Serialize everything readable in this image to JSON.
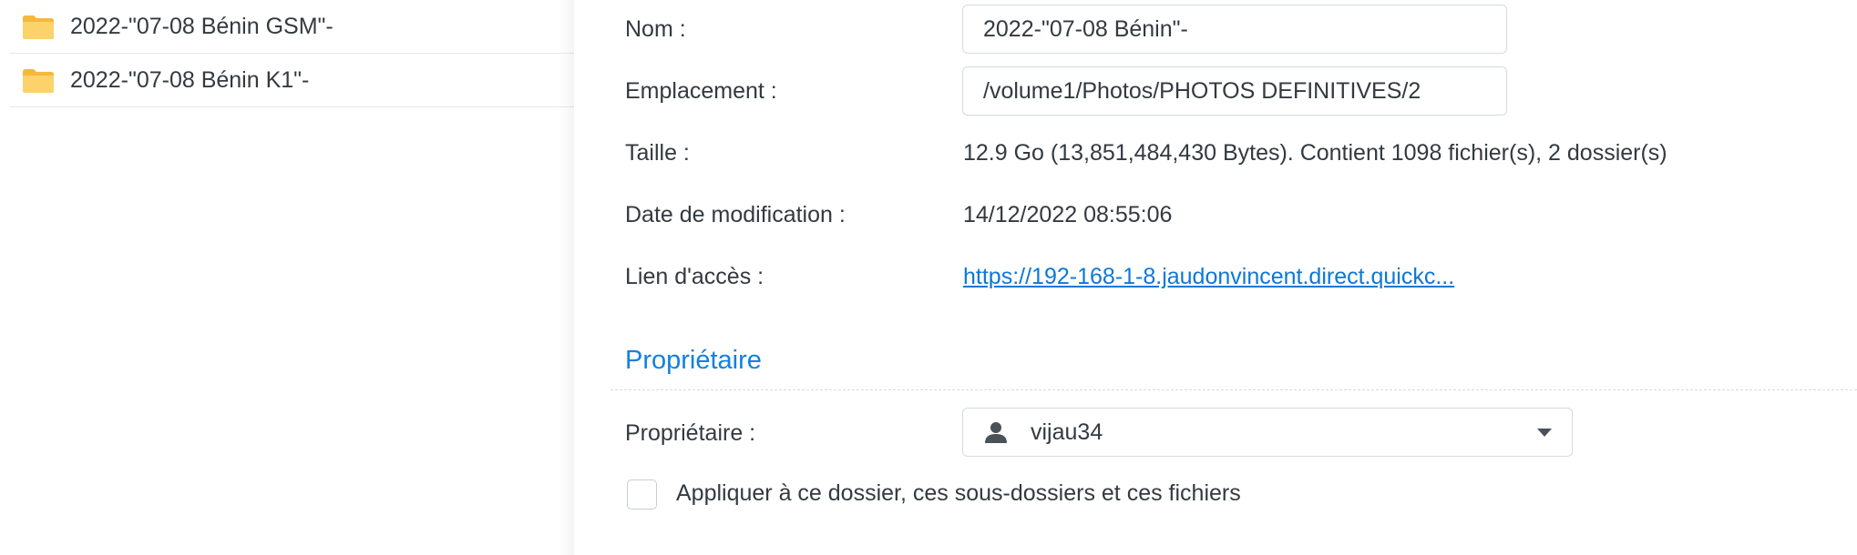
{
  "file_list": {
    "items": [
      {
        "name": "2022-\"07-08 Bénin GSM\"-",
        "icon": "folder-icon"
      },
      {
        "name": "2022-\"07-08 Bénin K1\"-",
        "icon": "folder-icon"
      }
    ]
  },
  "properties": {
    "name_label": "Nom :",
    "name_value": "2022-\"07-08 Bénin\"-",
    "location_label": "Emplacement :",
    "location_value": "/volume1/Photos/PHOTOS DEFINITIVES/2",
    "size_label": "Taille :",
    "size_value": "12.9 Go (13,851,484,430 Bytes). Contient 1098 fichier(s), 2 dossier(s)",
    "modified_label": "Date de modification :",
    "modified_value": "14/12/2022 08:55:06",
    "link_label": "Lien d'accès :",
    "link_value": "https://192-168-1-8.jaudonvincent.direct.quickc..."
  },
  "owner_section": {
    "title": "Propriétaire",
    "owner_label": "Propriétaire :",
    "owner_value": "vijau34",
    "owner_icon": "user-icon",
    "apply_label": "Appliquer à ce dossier, ces sous-dossiers et ces fichiers",
    "apply_checked": false
  },
  "colors": {
    "accent": "#1380de",
    "link": "#0b78d8",
    "folder": "#f7c244"
  }
}
